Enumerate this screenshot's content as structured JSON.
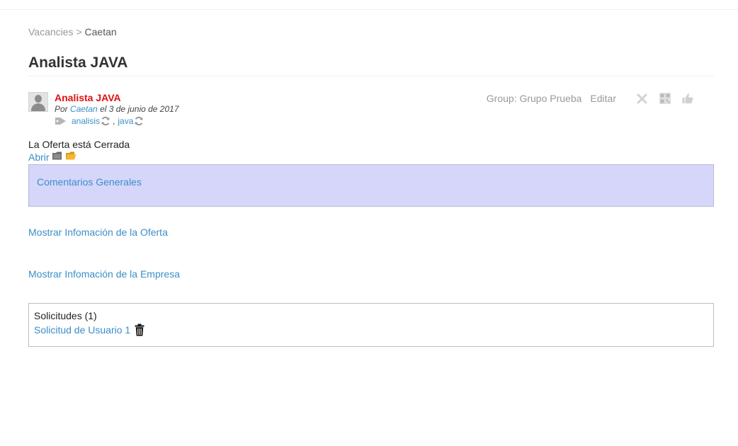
{
  "breadcrumb": {
    "parent": "Vacancies",
    "separator": ">",
    "current": "Caetan"
  },
  "page_title": "Analista JAVA",
  "post": {
    "title": "Analista JAVA",
    "by_prefix": "Por",
    "author": "Caetan",
    "date_text": "el 3 de junio de 2017",
    "tags": [
      {
        "label": "analisis"
      },
      {
        "label": "java"
      }
    ],
    "tag_separator": ",",
    "group_label": "Group: Grupo Prueba",
    "edit_label": "Editar"
  },
  "status_text": "La Oferta está Cerrada",
  "open_label": "Abrir",
  "comments_label": "Comentarios Generales",
  "offer_info_label": "Mostrar Infomación de la Oferta",
  "company_info_label": "Mostrar Infomación de la Empresa",
  "requests": {
    "title": "Solicitudes (1)",
    "items": [
      {
        "label": "Solicitud de Usuario 1"
      }
    ]
  },
  "colors": {
    "link": "#3a8fc6",
    "post_title": "#e01010",
    "comments_bg": "#d6d6fb"
  },
  "icons": {
    "avatar": "user-silhouette",
    "tag": "tag-icon",
    "refresh": "refresh-icon",
    "delete": "close-x-icon",
    "qr": "qr-code-icon",
    "like": "thumbs-up-icon",
    "folder_closed": "folder-closed-icon",
    "folder_open": "folder-open-icon",
    "trash": "trash-icon"
  }
}
